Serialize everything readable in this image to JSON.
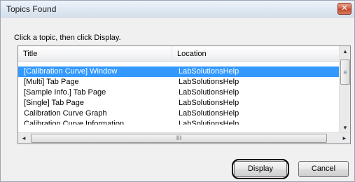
{
  "window": {
    "title": "Topics Found",
    "close_glyph": "✕"
  },
  "instruction": "Click a topic, then click Display.",
  "list": {
    "columns": [
      "Title",
      "Location"
    ],
    "rows": [
      {
        "title": "[Calibration Curve] Window",
        "location": "LabSolutionsHelp",
        "selected": true
      },
      {
        "title": "[Multi] Tab Page",
        "location": "LabSolutionsHelp",
        "selected": false
      },
      {
        "title": "[Sample Info.] Tab Page",
        "location": "LabSolutionsHelp",
        "selected": false
      },
      {
        "title": "[Single] Tab Page",
        "location": "LabSolutionsHelp",
        "selected": false
      },
      {
        "title": "Calibration Curve Graph",
        "location": "LabSolutionsHelp",
        "selected": false
      },
      {
        "title": "Calibration Curve Information",
        "location": "LabSolutionsHelp",
        "selected": false
      }
    ],
    "scroll": {
      "up": "▲",
      "down": "▼",
      "left": "◄",
      "right": "►",
      "grip_v": "≡",
      "grip_h": "III"
    }
  },
  "buttons": {
    "display": "Display",
    "cancel": "Cancel"
  },
  "colors": {
    "selection": "#3399ff",
    "titlebar": "#dfe8f2",
    "close": "#c2452a"
  }
}
